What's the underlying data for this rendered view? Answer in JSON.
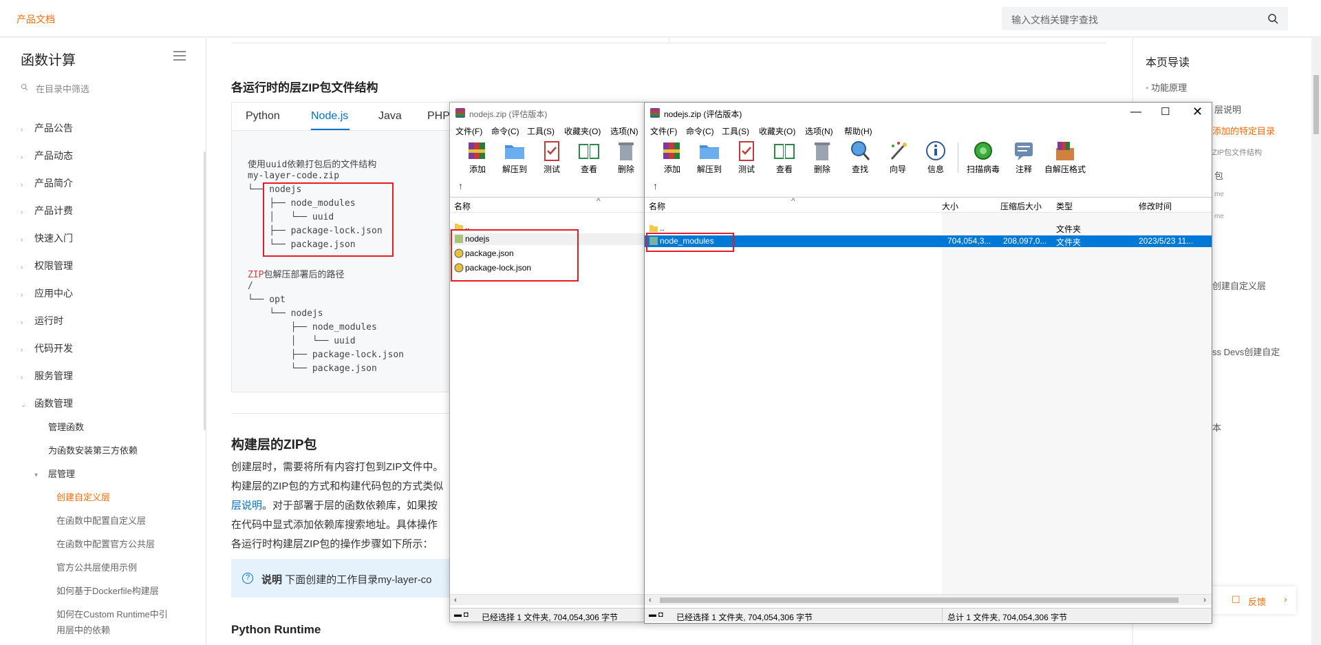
{
  "header": {
    "brand": "产品文档",
    "search_placeholder": "输入文档关键字查找"
  },
  "sidebar": {
    "title": "函数计算",
    "filter_placeholder": "在目录中筛选",
    "items": [
      "产品公告",
      "产品动态",
      "产品简介",
      "产品计费",
      "快速入门",
      "权限管理",
      "应用中心",
      "运行时",
      "代码开发",
      "服务管理",
      "函数管理"
    ],
    "sub_items": [
      "管理函数",
      "为函数安装第三方依赖",
      "层管理"
    ],
    "layer_items": [
      "创建自定义层",
      "在函数中配置自定义层",
      "在函数中配置官方公共层",
      "官方公共层使用示例",
      "如何基于Dockerfile构建层",
      "如何在Custom Runtime中引",
      "用层中的依赖"
    ]
  },
  "main": {
    "section_title": "各运行时的层ZIP包文件结构",
    "tabs": [
      "Python",
      "Node.js",
      "Java",
      "PHP"
    ],
    "code_lines_1": [
      "使用uuid依赖打包后的文件结构",
      "my-layer-code.zip",
      "└── nodejs",
      "    ├── node_modules",
      "    │   └── uuid",
      "    ├── package-lock.json",
      "    └── package.json"
    ],
    "code_zip": "ZIP",
    "code_path_rest": "包解压部署后的路径",
    "code_lines_2": [
      "/",
      "└── opt",
      "    └── nodejs",
      "        ├── node_modules",
      "        │   └── uuid",
      "        ├── package-lock.json",
      "        └── package.json"
    ],
    "build_title": "构建层的ZIP包",
    "para1": "创建层时，需要将所有内容打包到ZIP文件中。",
    "para2": "构建层的ZIP包的方式和构建代码包的方式类似",
    "para3_link": "层说明",
    "para3": "。对于部署于层的函数依赖库，如果按",
    "para4": "在代码中显式添加依赖库搜索地址。具体操作",
    "para5": "各运行时构建层ZIP包的操作步骤如下所示：",
    "note_label": "说明",
    "note_text": "下面创建的工作目录my-layer-co",
    "python_title": "Python Runtime"
  },
  "toc": {
    "title": "本页导读",
    "items": [
      "功能原理",
      "层说明",
      "添加的特定目录",
      "ZIP包文件结构",
      "包",
      "me",
      "me",
      "创建自定义层",
      "ss Devs创建自定",
      "本"
    ],
    "feedback": "反馈"
  },
  "win1": {
    "title": "nodejs.zip",
    "title_suffix": "(评估版本)",
    "menu": [
      "文件(F)",
      "命令(C)",
      "工具(S)",
      "收藏夹(O)",
      "选项(N)"
    ],
    "tools": [
      "添加",
      "解压到",
      "测试",
      "查看",
      "删除"
    ],
    "col_name": "名称",
    "rows": [
      "..",
      "nodejs",
      "package.json",
      "package-lock.json"
    ],
    "status": "已经选择 1 文件夹, 704,054,306 字节"
  },
  "win2": {
    "title": "nodejs.zip",
    "title_suffix": "(评估版本)",
    "menu": [
      "文件(F)",
      "命令(C)",
      "工具(S)",
      "收藏夹(O)",
      "选项(N)",
      "帮助(H)"
    ],
    "tools": [
      "添加",
      "解压到",
      "测试",
      "查看",
      "删除",
      "查找",
      "向导",
      "信息",
      "扫描病毒",
      "注释",
      "自解压格式"
    ],
    "cols": [
      "名称",
      "大小",
      "压缩后大小",
      "类型",
      "修改时间"
    ],
    "rows": [
      {
        "name": "..",
        "size": "",
        "packed": "",
        "type": "文件夹",
        "modified": ""
      },
      {
        "name": "node_modules",
        "size": "704,054,3...",
        "packed": "208,097,0...",
        "type": "文件夹",
        "modified": "2023/5/23 11..."
      }
    ],
    "status_left": "已经选择 1 文件夹, 704,054,306 字节",
    "status_right": "总计 1 文件夹, 704,054,306 字节"
  },
  "colors": {
    "accent": "#ff6a00",
    "link": "#0070cc",
    "highlight": "#e51c23",
    "selection": "#0078d7"
  }
}
